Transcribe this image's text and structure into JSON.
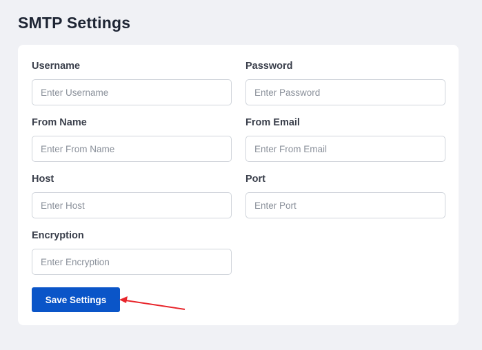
{
  "page": {
    "title": "SMTP Settings"
  },
  "form": {
    "username": {
      "label": "Username",
      "placeholder": "Enter Username",
      "value": ""
    },
    "password": {
      "label": "Password",
      "placeholder": "Enter Password",
      "value": ""
    },
    "from_name": {
      "label": "From Name",
      "placeholder": "Enter From Name",
      "value": ""
    },
    "from_email": {
      "label": "From Email",
      "placeholder": "Enter From Email",
      "value": ""
    },
    "host": {
      "label": "Host",
      "placeholder": "Enter Host",
      "value": ""
    },
    "port": {
      "label": "Port",
      "placeholder": "Enter Port",
      "value": ""
    },
    "encryption": {
      "label": "Encryption",
      "placeholder": "Enter Encryption",
      "value": ""
    },
    "save_label": "Save Settings"
  },
  "colors": {
    "accent": "#0a55c8",
    "annotation_arrow": "#e8252b",
    "background": "#f0f1f5"
  }
}
